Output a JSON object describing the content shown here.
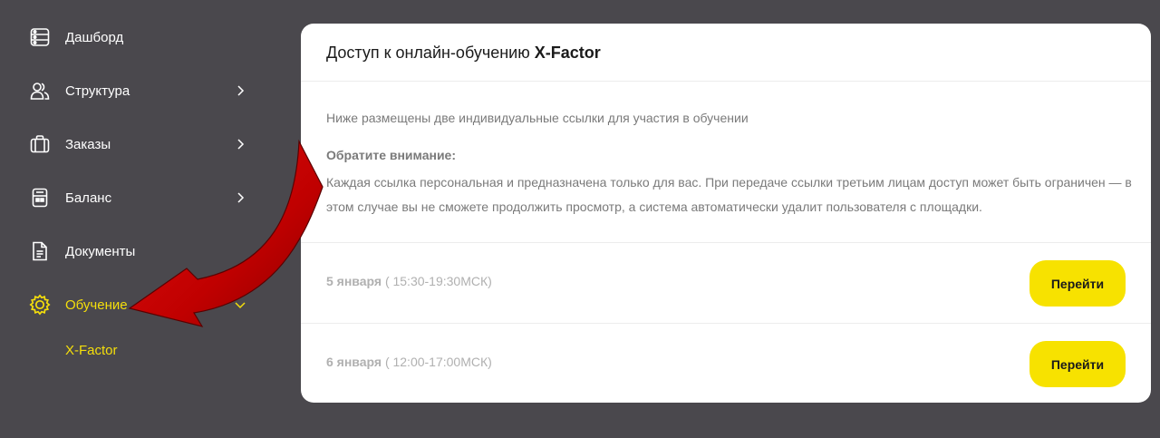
{
  "sidebar": {
    "items": [
      {
        "label": "Дашборд",
        "icon": "dashboard-icon",
        "has_chevron": false
      },
      {
        "label": "Структура",
        "icon": "users-icon",
        "has_chevron": true
      },
      {
        "label": "Заказы",
        "icon": "briefcase-icon",
        "has_chevron": true
      },
      {
        "label": "Баланс",
        "icon": "wallet-icon",
        "has_chevron": true
      },
      {
        "label": "Документы",
        "icon": "document-icon",
        "has_chevron": false
      },
      {
        "label": "Обучение",
        "icon": "gear-icon",
        "has_chevron": true,
        "expanded": true,
        "active": true
      }
    ],
    "subitems": [
      {
        "label": "X-Factor"
      }
    ]
  },
  "card": {
    "title_prefix": "Доступ к онлайн-обучению ",
    "title_brand": "X-Factor",
    "intro": "Ниже размещены две индивидуальные ссылки для участия в обучении",
    "notice_title": "Обратите внимание:",
    "notice_text": "Каждая ссылка персональная и предназначена только для вас. При передаче ссылки третьим лицам доступ может быть ограничен — в этом случае вы не сможете продолжить просмотр, а система автоматически удалит пользователя с площадки.",
    "sessions": [
      {
        "day": "5 января",
        "time": "( 15:30-19:30МСК)",
        "button_label": "Перейти"
      },
      {
        "day": "6 января",
        "time": "( 12:00-17:00МСК)",
        "button_label": "Перейти"
      }
    ]
  },
  "colors": {
    "background": "#4a484d",
    "accent": "#f5df0b",
    "button": "#f7e200",
    "arrow": "#c40000"
  }
}
